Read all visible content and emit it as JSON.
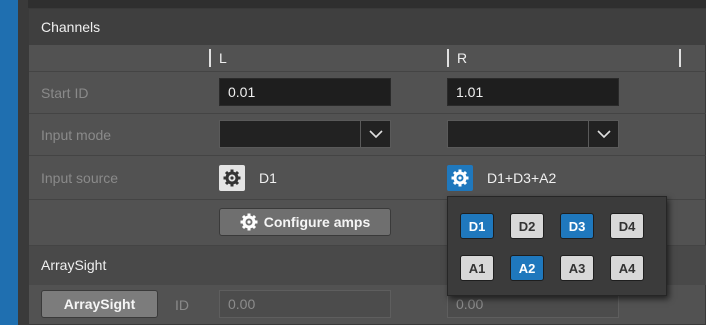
{
  "section": {
    "title": "Channels",
    "columns": [
      "L",
      "R"
    ]
  },
  "rows": {
    "start_id": {
      "label": "Start ID",
      "left": "0.01",
      "right": "1.01"
    },
    "input_mode": {
      "label": "Input mode",
      "left": "",
      "right": ""
    },
    "input_source": {
      "label": "Input source",
      "left": "D1",
      "right": "D1+D3+A2"
    }
  },
  "actions": {
    "configure_amps": "Configure amps"
  },
  "arraysight": {
    "title": "ArraySight",
    "button": "ArraySight",
    "id_label": "ID",
    "left_value": "0.00",
    "right_value": "0.00"
  },
  "popup": {
    "row1": [
      {
        "label": "D1",
        "active": true
      },
      {
        "label": "D2",
        "active": false
      },
      {
        "label": "D3",
        "active": true
      },
      {
        "label": "D4",
        "active": false
      }
    ],
    "row2": [
      {
        "label": "A1",
        "active": false
      },
      {
        "label": "A2",
        "active": true
      },
      {
        "label": "A3",
        "active": false
      },
      {
        "label": "A4",
        "active": false
      }
    ]
  },
  "colors": {
    "accent": "#1f78bd",
    "panel": "#525252",
    "field": "#1e1e1e"
  },
  "icons": [
    "gear-icon",
    "chevron-down-icon"
  ]
}
